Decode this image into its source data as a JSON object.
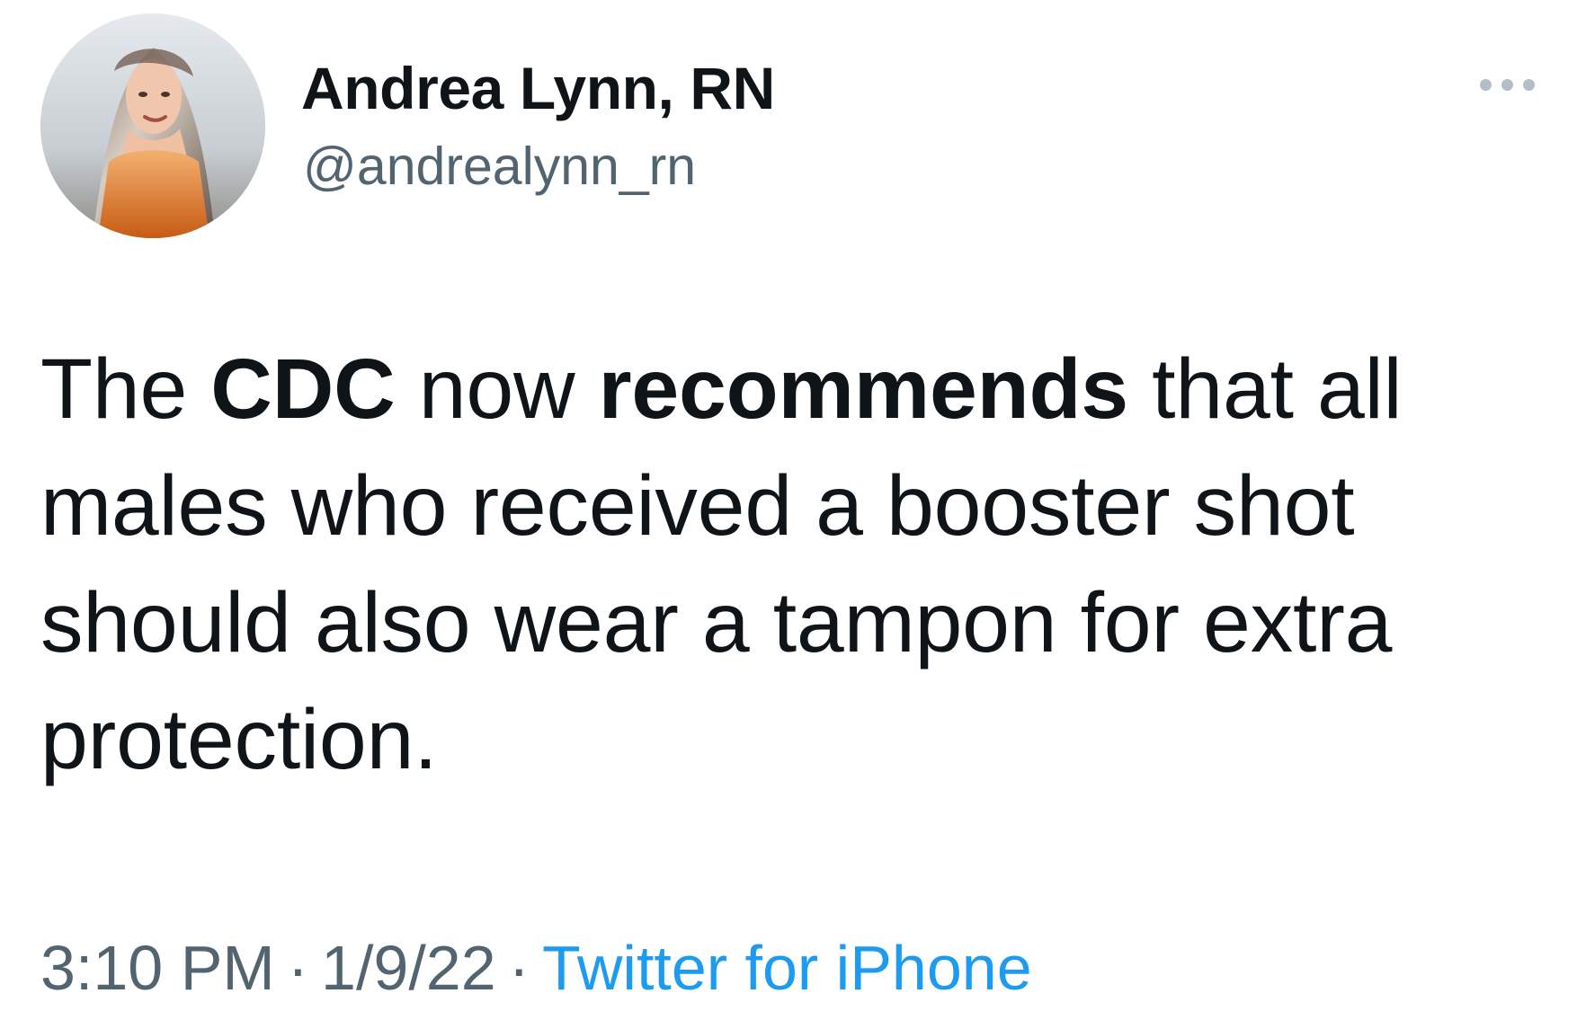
{
  "tweet": {
    "author": {
      "display_name": "Andrea Lynn, RN",
      "handle": "@andrealynn_rn",
      "avatar_icon": "profile-photo-avatar-icon"
    },
    "more_icon": "more-options-icon",
    "text_lines": [
      [
        {
          "text": "The ",
          "bold": false
        },
        {
          "text": "CDC",
          "bold": true
        },
        {
          "text": " now ",
          "bold": false
        },
        {
          "text": "recommends",
          "bold": true
        },
        {
          "text": " that all",
          "bold": false
        }
      ],
      [
        {
          "text": "males who received a booster shot",
          "bold": false
        }
      ],
      [
        {
          "text": "should also wear a tampon for extra",
          "bold": false
        }
      ],
      [
        {
          "text": "protection.",
          "bold": false
        }
      ]
    ],
    "metadata": {
      "time": "3:10 PM",
      "separator": "·",
      "date": "1/9/22",
      "source": "Twitter for iPhone"
    },
    "colors": {
      "text": "#0f1419",
      "secondary": "#536471",
      "link": "#1d9bf0",
      "menu_dots": "#b3bec8",
      "background": "#ffffff"
    }
  }
}
